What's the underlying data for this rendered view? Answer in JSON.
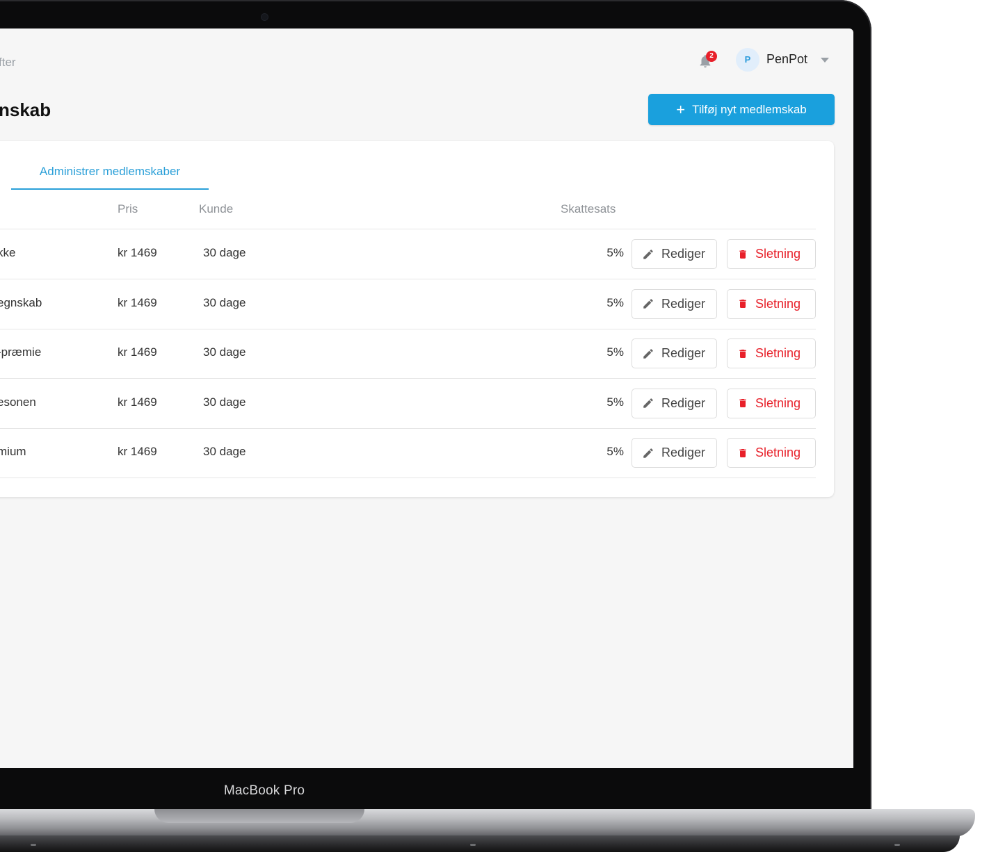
{
  "device": {
    "brand_label": "MacBook Pro"
  },
  "header": {
    "breadcrumb": "fter",
    "page_title": "nskab",
    "notification_count": "2",
    "user": {
      "initial": "P",
      "name": "PenPot"
    },
    "add_button_label": "Tilføj nyt medlemskab",
    "add_button_icon": "plus-icon"
  },
  "tabs": [
    {
      "label": "Administrer medlemskaber",
      "active": true
    }
  ],
  "table": {
    "columns": {
      "price": "Pris",
      "customer": "Kunde",
      "tax": "Skattesats"
    },
    "rows": [
      {
        "name": "kke",
        "price": "kr 1469",
        "customer": "30 dage",
        "tax": "5%",
        "edit": "Rediger",
        "delete": "Sletning"
      },
      {
        "name": "egnskab",
        "price": "kr 1469",
        "customer": "30 dage",
        "tax": "5%",
        "edit": "Rediger",
        "delete": "Sletning"
      },
      {
        "name": "-præmie",
        "price": "kr 1469",
        "customer": "30 dage",
        "tax": "5%",
        "edit": "Rediger",
        "delete": "Sletning"
      },
      {
        "name": "esonen",
        "price": "kr 1469",
        "customer": "30 dage",
        "tax": "5%",
        "edit": "Rediger",
        "delete": "Sletning"
      },
      {
        "name": "mium",
        "price": "kr 1469",
        "customer": "30 dage",
        "tax": "5%",
        "edit": "Rediger",
        "delete": "Sletning"
      }
    ]
  },
  "colors": {
    "accent": "#1aa0dd",
    "danger": "#e8202a",
    "background": "#f6f6f6"
  }
}
